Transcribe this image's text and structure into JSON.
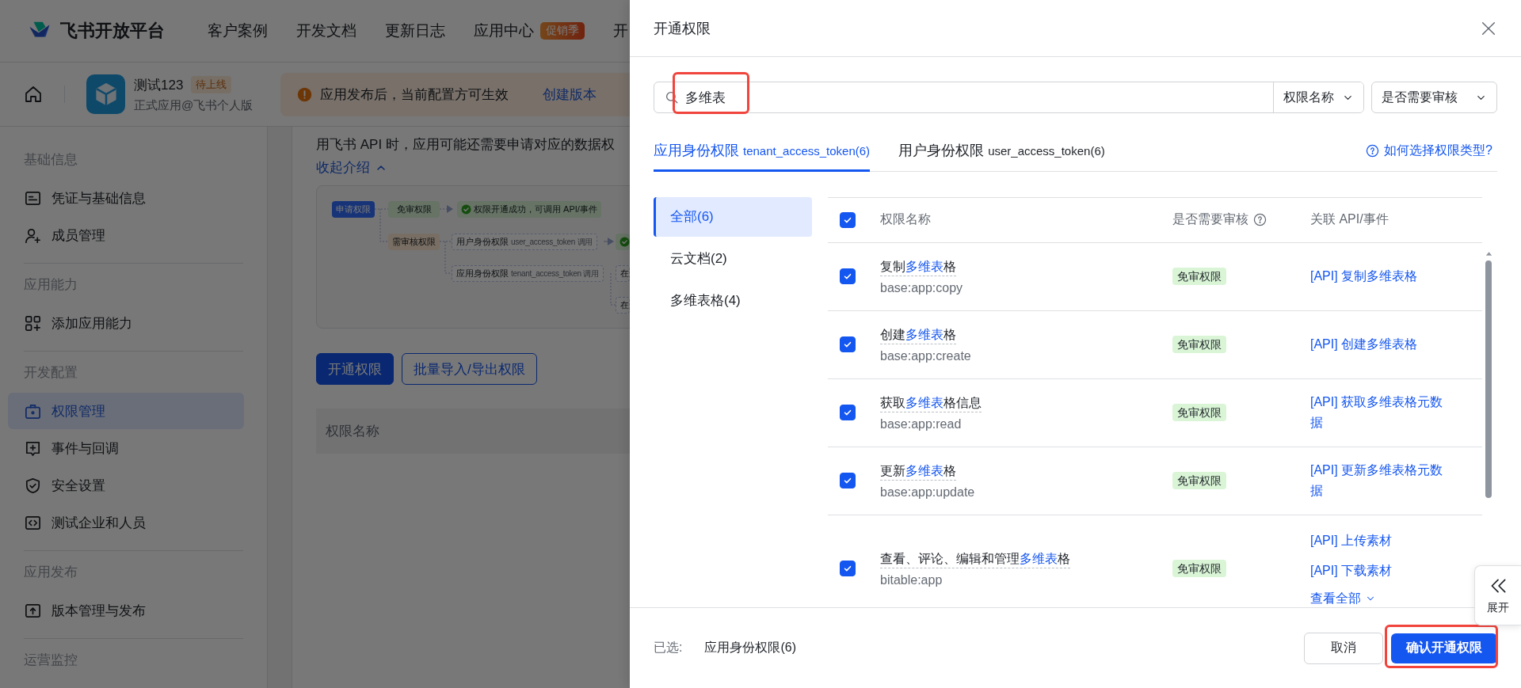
{
  "header": {
    "logo_text": "飞书开放平台",
    "nav": [
      {
        "label": "客户案例"
      },
      {
        "label": "开发文档"
      },
      {
        "label": "更新日志"
      },
      {
        "label": "应用中心",
        "badge": "促销季"
      },
      {
        "label": "开"
      }
    ]
  },
  "app_bar": {
    "app_name": "测试123",
    "status": "待上线",
    "app_type": "正式应用@飞书个人版",
    "notice": "应用发布后，当前配置方可生效",
    "notice_link": "创建版本"
  },
  "sidebar": {
    "sections": [
      {
        "title": "基础信息",
        "items": [
          {
            "label": "凭证与基础信息",
            "selected": false
          },
          {
            "label": "成员管理",
            "selected": false
          }
        ]
      },
      {
        "title": "应用能力",
        "items": [
          {
            "label": "添加应用能力",
            "selected": false
          }
        ]
      },
      {
        "title": "开发配置",
        "items": [
          {
            "label": "权限管理",
            "selected": true
          },
          {
            "label": "事件与回调",
            "selected": false
          },
          {
            "label": "安全设置",
            "selected": false
          },
          {
            "label": "测试企业和人员",
            "selected": false
          }
        ]
      },
      {
        "title": "应用发布",
        "items": [
          {
            "label": "版本管理与发布",
            "selected": false
          }
        ]
      },
      {
        "title": "运营监控"
      }
    ]
  },
  "content": {
    "intro_text": "用飞书 API 时，应用可能还需要申请对应的数据权",
    "collapse_link": "收起介绍",
    "diagram": {
      "nodes": [
        {
          "kind": "primary",
          "text": "申请权限"
        },
        {
          "kind": "green",
          "text": "免审权限"
        },
        {
          "kind": "success",
          "text": "权限开通成功，可调用 API/事件"
        },
        {
          "kind": "orange",
          "text": "需审核权限"
        },
        {
          "kind": "dashed",
          "text": "用户身份权限",
          "sub": "user_access_token 调用"
        },
        {
          "kind": "success-cut"
        },
        {
          "kind": "dashed",
          "text": "应用身份权限",
          "sub": "tenant_access_token 调用"
        },
        {
          "kind": "dashed",
          "text": "在"
        },
        {
          "kind": "dashed",
          "text": "在"
        }
      ]
    },
    "buttons": [
      {
        "label": "开通权限",
        "kind": "primary"
      },
      {
        "label": "批量导入/导出权限",
        "kind": "outline"
      }
    ],
    "table_header": "权限名称"
  },
  "drawer": {
    "title": "开通权限",
    "search": {
      "value": "多维表"
    },
    "filters": [
      {
        "label": "权限名称"
      },
      {
        "label": "是否需要审核"
      }
    ],
    "tabs": [
      {
        "label": "应用身份权限",
        "token": "tenant_access_token(6)",
        "selected": true
      },
      {
        "label": "用户身份权限",
        "token": "user_access_token(6)",
        "selected": false
      }
    ],
    "help_link": "如何选择权限类型?",
    "categories": [
      {
        "label": "全部(6)",
        "selected": true
      },
      {
        "label": "云文档(2)",
        "selected": false
      },
      {
        "label": "多维表格(4)",
        "selected": false
      }
    ],
    "table": {
      "all_checked": true,
      "columns": [
        "权限名称",
        "是否需要审核",
        "关联 API/事件"
      ],
      "rows": [
        {
          "checked": true,
          "name": {
            "prefix": "复制",
            "match": "多维表",
            "suffix": "格"
          },
          "code": "base:app:copy",
          "review": "免审权限",
          "apis": [
            "[API] 复制多维表格"
          ]
        },
        {
          "checked": true,
          "name": {
            "prefix": "创建",
            "match": "多维表",
            "suffix": "格"
          },
          "code": "base:app:create",
          "review": "免审权限",
          "apis": [
            "[API] 创建多维表格"
          ]
        },
        {
          "checked": true,
          "name": {
            "prefix": "获取",
            "match": "多维表",
            "suffix": "格信息"
          },
          "code": "base:app:read",
          "review": "免审权限",
          "apis": [
            "[API] 获取多维表格元数据"
          ]
        },
        {
          "checked": true,
          "name": {
            "prefix": "更新",
            "match": "多维表",
            "suffix": "格"
          },
          "code": "base:app:update",
          "review": "免审权限",
          "apis": [
            "[API] 更新多维表格元数据"
          ]
        },
        {
          "checked": true,
          "name": {
            "prefix": "查看、评论、编辑和管理",
            "match": "多维表",
            "suffix": "格"
          },
          "code": "bitable:app",
          "review": "免审权限",
          "apis": [
            "[API] 上传素材",
            "[API] 下载素材"
          ],
          "show_all": "查看全部"
        }
      ]
    },
    "footer": {
      "selected_label": "已选:",
      "selected_value": "应用身份权限(6)",
      "cancel": "取消",
      "confirm": "确认开通权限"
    },
    "side_tab": {
      "label": "展开"
    }
  }
}
